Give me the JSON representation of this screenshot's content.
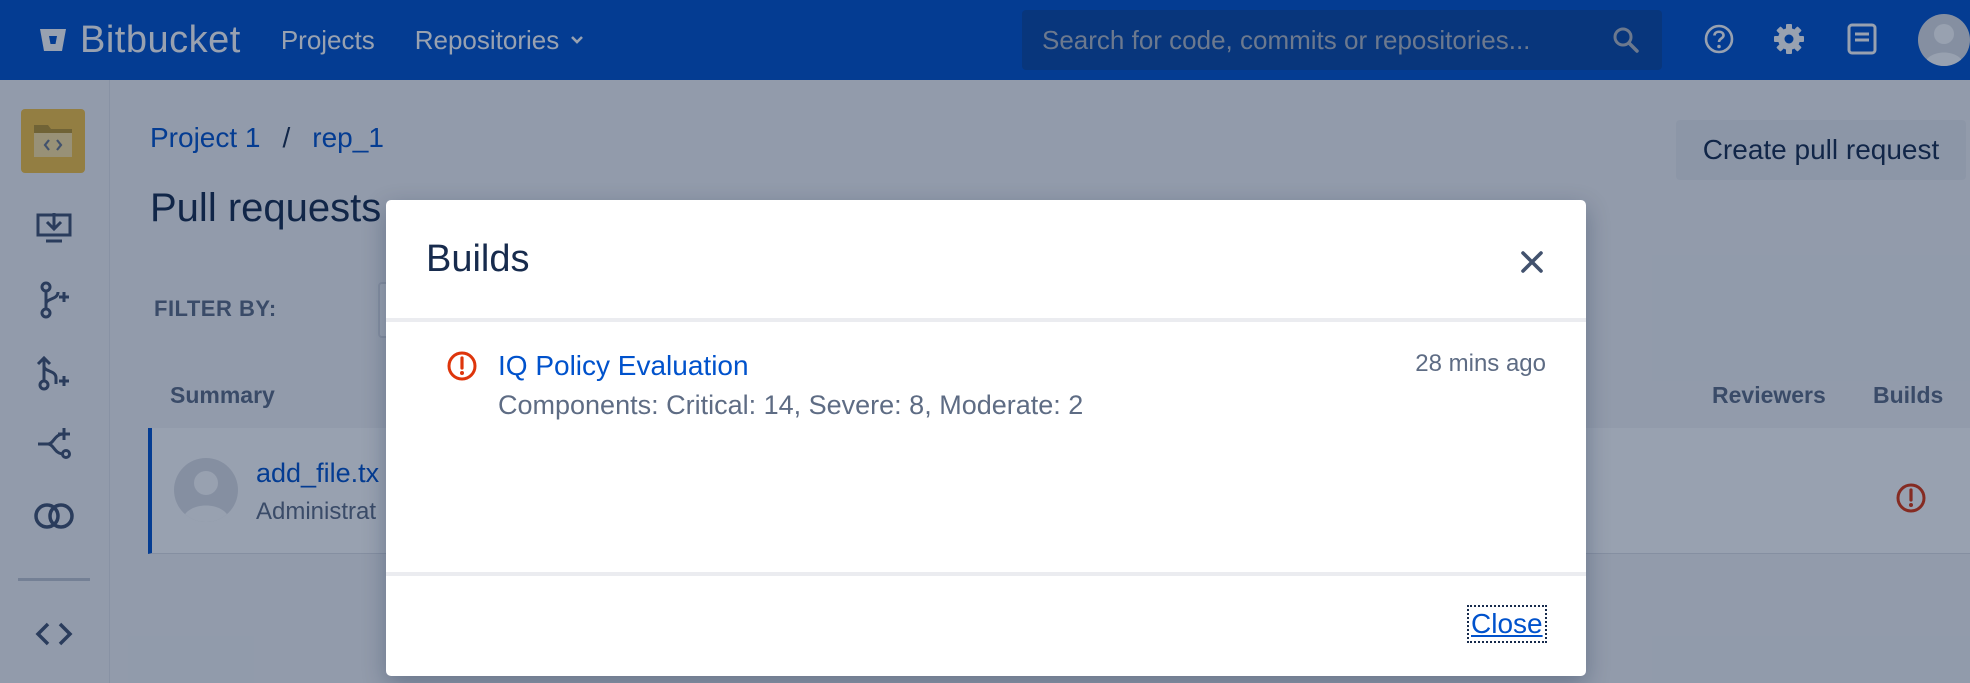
{
  "app": {
    "name": "Bitbucket"
  },
  "nav": {
    "projects": "Projects",
    "repositories": "Repositories",
    "search_placeholder": "Search for code, commits or repositories..."
  },
  "breadcrumb": {
    "project": "Project 1",
    "separator": "/",
    "repo": "rep_1"
  },
  "page": {
    "title": "Pull requests",
    "create_pr": "Create pull request",
    "filter_label": "FILTER BY:"
  },
  "table": {
    "columns": {
      "summary": "Summary",
      "reviewers": "Reviewers",
      "builds": "Builds"
    },
    "row": {
      "title": "add_file.tx",
      "author": "Administrat"
    }
  },
  "dialog": {
    "title": "Builds",
    "build": {
      "name": "IQ Policy Evaluation",
      "time": "28 mins ago",
      "description": "Components: Critical: 14, Severe: 8, Moderate: 2",
      "status": "failed"
    },
    "close_label": "Close"
  },
  "colors": {
    "brand": "#0052cc",
    "error": "#de350b",
    "project_avatar": "#f6c342"
  }
}
